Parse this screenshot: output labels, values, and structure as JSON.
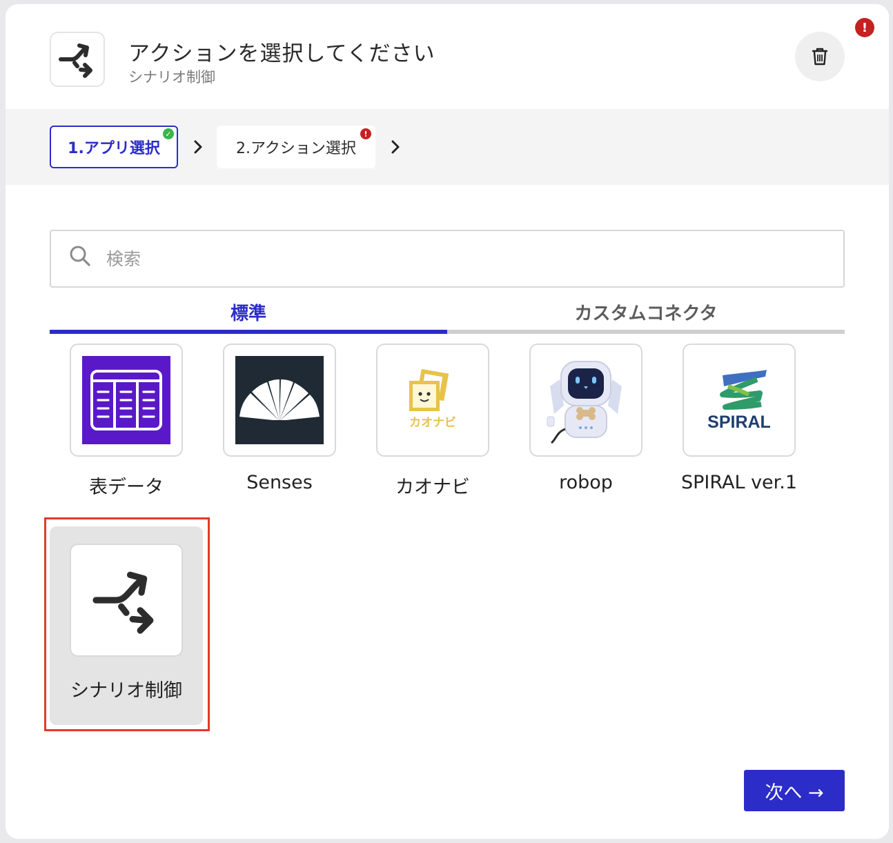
{
  "header": {
    "title": "アクションを選択してください",
    "subtitle": "シナリオ制御",
    "icon": "branch-arrows-icon",
    "error_badge": "!"
  },
  "steps": [
    {
      "label": "1.アプリ選択",
      "status": "complete",
      "status_badge": "✓"
    },
    {
      "label": "2.アクション選択",
      "status": "error",
      "status_badge": "!"
    }
  ],
  "search": {
    "placeholder": "検索",
    "value": ""
  },
  "tabs": [
    {
      "label": "標準",
      "active": true
    },
    {
      "label": "カスタムコネクタ",
      "active": false
    }
  ],
  "apps": [
    {
      "label": "表データ",
      "icon": "table-data-icon"
    },
    {
      "label": "Senses",
      "icon": "senses-logo-icon"
    },
    {
      "label": "カオナビ",
      "icon": "kaonavi-logo-icon",
      "logo_text": "カオナビ"
    },
    {
      "label": "robop",
      "icon": "robop-robot-icon"
    },
    {
      "label": "SPIRAL ver.1",
      "icon": "spiral-logo-icon",
      "logo_text": "SPIRAL"
    },
    {
      "label": "シナリオ制御",
      "icon": "branch-arrows-icon",
      "selected": true
    }
  ],
  "footer": {
    "next_label": "次へ →"
  },
  "colors": {
    "accent": "#2c2cc9",
    "error": "#c62020",
    "success": "#39b54a",
    "selection_outline": "#e23a26",
    "table_app_bg": "#5a19c8",
    "senses_bg": "#1f2a34",
    "kaonavi_yellow": "#e8c24a"
  }
}
